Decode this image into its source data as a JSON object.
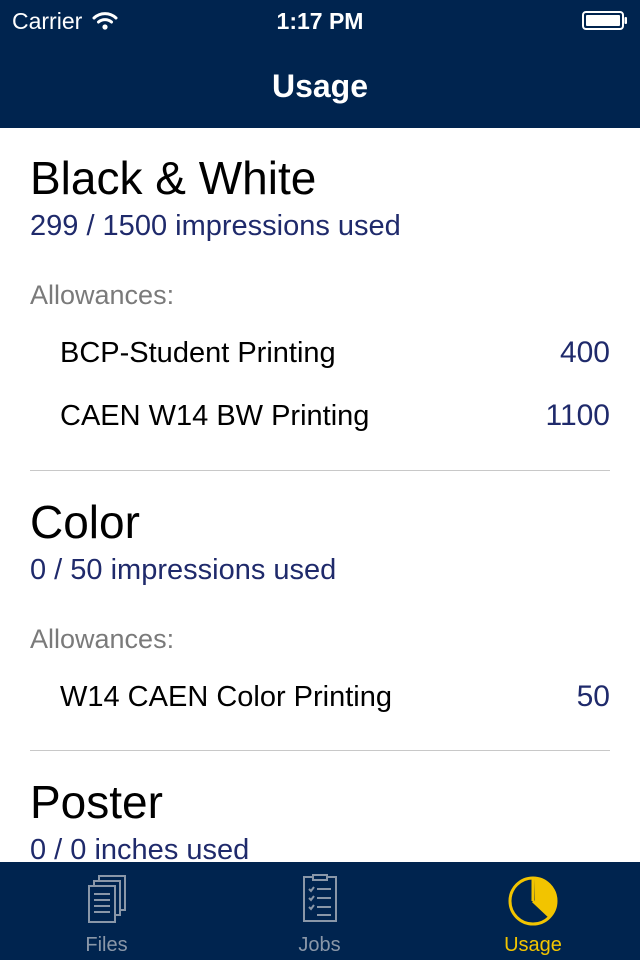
{
  "status_bar": {
    "carrier": "Carrier",
    "time": "1:17 PM"
  },
  "nav": {
    "title": "Usage"
  },
  "sections": [
    {
      "title": "Black & White",
      "used": "299 / 1500 impressions used",
      "allowances_label": "Allowances:",
      "allowances": [
        {
          "name": "BCP-Student Printing",
          "value": "400"
        },
        {
          "name": "CAEN W14 BW Printing",
          "value": "1100"
        }
      ]
    },
    {
      "title": "Color",
      "used": "0 / 50 impressions used",
      "allowances_label": "Allowances:",
      "allowances": [
        {
          "name": "W14 CAEN Color Printing",
          "value": "50"
        }
      ]
    },
    {
      "title": "Poster",
      "used": "0 / 0 inches used"
    }
  ],
  "tabs": [
    {
      "label": "Files",
      "icon": "files-icon",
      "active": false
    },
    {
      "label": "Jobs",
      "icon": "jobs-icon",
      "active": false
    },
    {
      "label": "Usage",
      "icon": "pie-chart-icon",
      "active": true
    }
  ],
  "colors": {
    "bar_bg": "#00244f",
    "accent_active": "#f2c400",
    "tab_inactive": "#8a97a8",
    "value_text": "#1f2a6b"
  }
}
